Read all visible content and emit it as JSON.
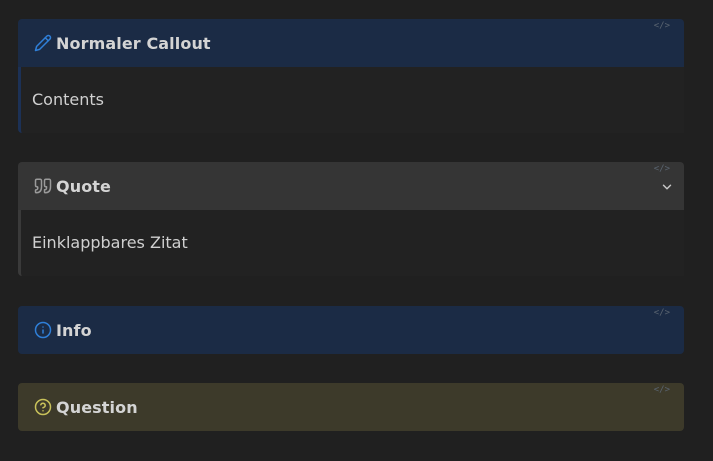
{
  "callouts": {
    "note": {
      "title": "Normaler Callout",
      "body": "Contents",
      "icon": "pencil-icon",
      "code_tag": "</>"
    },
    "quote": {
      "title": "Quote",
      "body": "Einklappbares Zitat",
      "icon": "quote-icon",
      "code_tag": "</>",
      "collapsible_icon": "chevron-down-icon"
    },
    "info": {
      "title": "Info",
      "icon": "info-icon",
      "code_tag": "</>"
    },
    "question": {
      "title": "Question",
      "icon": "question-icon",
      "code_tag": "</>"
    }
  },
  "colors": {
    "background": "#202020",
    "note_accent": "#2f7fd8",
    "info_accent": "#2f7fd8",
    "question_accent": "#c9c25a",
    "quote_icon": "#9a9a9a"
  }
}
